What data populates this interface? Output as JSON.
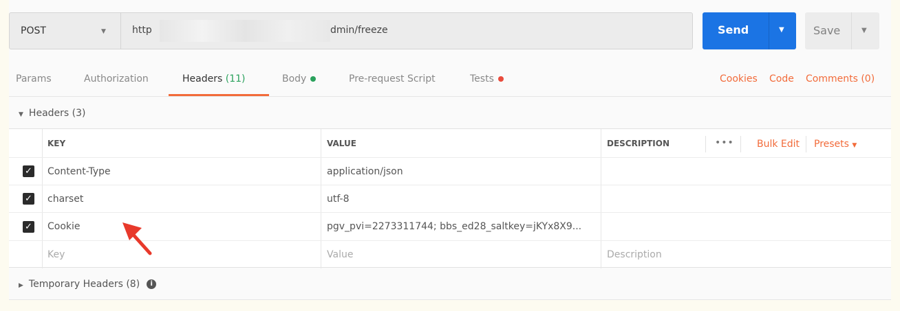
{
  "request": {
    "method": "POST",
    "url_visible_start": "http",
    "url_visible_end": "dmin/freeze",
    "send_label": "Send",
    "save_label": "Save"
  },
  "tabs": [
    {
      "label": "Params"
    },
    {
      "label": "Authorization"
    },
    {
      "label": "Headers",
      "count": "(11)",
      "active": true
    },
    {
      "label": "Body",
      "dot_color": "#2aa15c"
    },
    {
      "label": "Pre-request Script"
    },
    {
      "label": "Tests",
      "dot_color": "#e94b3c"
    }
  ],
  "right_links": {
    "cookies": "Cookies",
    "code": "Code",
    "comments": "Comments (0)"
  },
  "headers_section": {
    "title": "Headers (3)",
    "columns": {
      "key": "KEY",
      "value": "VALUE",
      "description": "DESCRIPTION"
    },
    "more_icon": "•••",
    "bulk_edit": "Bulk Edit",
    "presets": "Presets",
    "rows": [
      {
        "checked": true,
        "key": "Content-Type",
        "value": "application/json"
      },
      {
        "checked": true,
        "key": "charset",
        "value": "utf-8"
      },
      {
        "checked": true,
        "key": "Cookie",
        "value": "pgv_pvi=2273311744; bbs_ed28_saltkey=jKYx8X9..."
      }
    ],
    "placeholders": {
      "key": "Key",
      "value": "Value",
      "description": "Description"
    }
  },
  "temporary_headers": {
    "title": "Temporary Headers (8)"
  },
  "colors": {
    "accent": "#f26b3a",
    "send_button": "#1b74e4",
    "annotation_arrow": "#e8392b"
  }
}
